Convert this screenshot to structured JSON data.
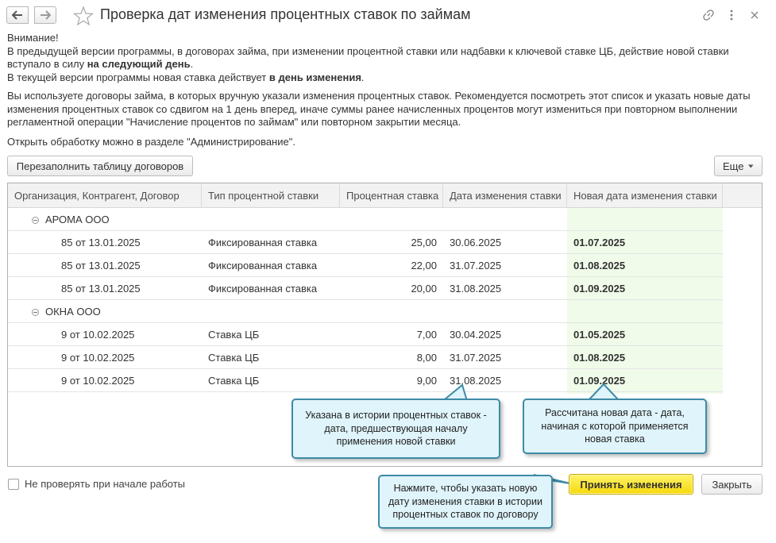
{
  "window": {
    "title": "Проверка дат изменения процентных ставок по займам"
  },
  "info": {
    "line1": "Внимание!",
    "line2": "В предыдущей версии программы, в договорах займа, при изменении процентной ставки или надбавки к ключевой ставке ЦБ, действие новой ставки",
    "line3_pre": "вступало в силу ",
    "line3_bold": "на следующий день",
    "line3_post": ".",
    "line4_pre": "В текущей версии программы новая ставка действует ",
    "line4_bold": "в день изменения",
    "line4_post": ".",
    "para2_l1": "Вы используете договоры займа, в которых вручную указали изменения процентных ставок. Рекомендуется посмотреть этот список и указать новые даты",
    "para2_l2": "изменения процентных ставок со сдвигом на 1 день вперед, иначе суммы ранее начисленных процентов могут измениться при повторном выполнении",
    "para2_l3": "регламентной операции \"Начисление процентов по займам\" или повторном закрытии месяца.",
    "para3": "Открыть обработку можно в разделе \"Администрирование\"."
  },
  "toolbar": {
    "refill_label": "Перезаполнить таблицу договоров",
    "more_label": "Еще"
  },
  "table": {
    "columns": [
      "Организация, Контрагент, Договор",
      "Тип процентной ставки",
      "Процентная ставка",
      "Дата изменения ставки",
      "Новая дата изменения ставки"
    ],
    "groups": [
      {
        "name": "АРОМА ООО",
        "rows": [
          {
            "contract": "85 от 13.01.2025",
            "type": "Фиксированная ставка",
            "rate": "25,00",
            "date": "30.06.2025",
            "new_date": "01.07.2025"
          },
          {
            "contract": "85 от 13.01.2025",
            "type": "Фиксированная ставка",
            "rate": "22,00",
            "date": "31.07.2025",
            "new_date": "01.08.2025"
          },
          {
            "contract": "85 от 13.01.2025",
            "type": "Фиксированная ставка",
            "rate": "20,00",
            "date": "31.08.2025",
            "new_date": "01.09.2025"
          }
        ]
      },
      {
        "name": "ОКНА ООО",
        "rows": [
          {
            "contract": "9 от 10.02.2025",
            "type": "Ставка ЦБ",
            "rate": "7,00",
            "date": "30.04.2025",
            "new_date": "01.05.2025"
          },
          {
            "contract": "9 от 10.02.2025",
            "type": "Ставка ЦБ",
            "rate": "8,00",
            "date": "31.07.2025",
            "new_date": "01.08.2025"
          },
          {
            "contract": "9 от 10.02.2025",
            "type": "Ставка ЦБ",
            "rate": "9,00",
            "date": "31.08.2025",
            "new_date": "01.09.2025"
          }
        ]
      }
    ]
  },
  "callouts": {
    "history": "Указана в истории процентных ставок - дата, предшествующая началу применения новой ставки",
    "calculated": "Рассчитана новая дата - дата, начиная с которой применяется новая ставка",
    "click": "Нажмите, чтобы указать новую дату изменения ставки в истории процентных ставок по договору"
  },
  "footer": {
    "checkbox_label": "Не проверять при начале работы",
    "accept_label": "Принять изменения",
    "close_label": "Закрыть"
  },
  "colors": {
    "accent_button": "#f5d90a",
    "new_date_column": "#f0fbe9",
    "callout_bg": "#dff4fb",
    "callout_border": "#3e8aa6"
  },
  "icons": {
    "back": "arrow-left-icon",
    "forward": "arrow-right-icon",
    "favorite": "star-icon",
    "link": "link-icon",
    "menu": "more-vertical-icon",
    "close": "close-icon"
  }
}
